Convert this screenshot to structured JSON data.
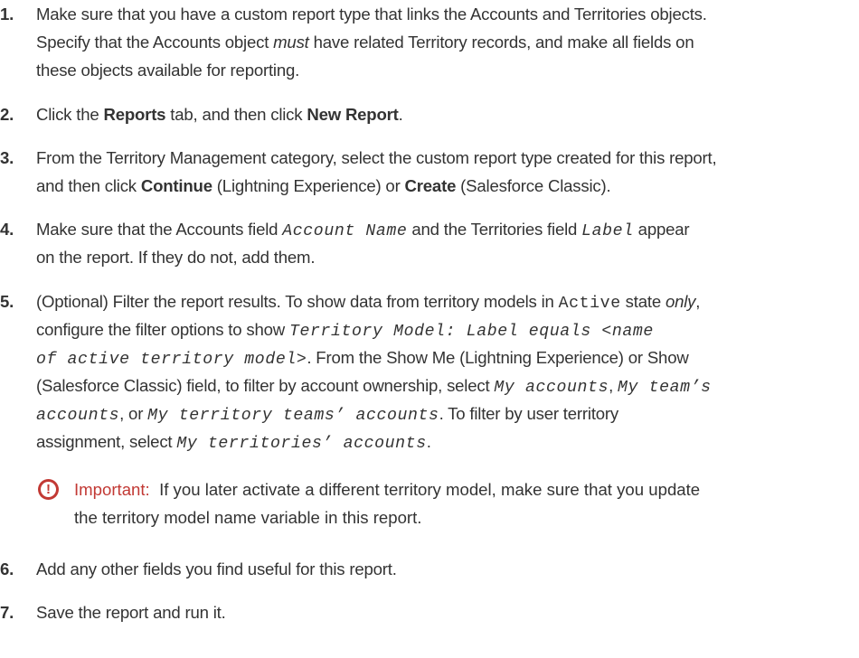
{
  "steps": [
    {
      "num": "1.",
      "lines": [
        "Make sure that you have a custom report type that links the Accounts and Territories objects.",
        [
          "Specify that the Accounts object ",
          {
            "i": "must"
          },
          " have related Territory records, and make all fields on"
        ],
        "these objects available for reporting."
      ]
    },
    {
      "num": "2.",
      "lines": [
        [
          "Click the ",
          {
            "b": "Reports"
          },
          " tab, and then click ",
          {
            "b": "New Report"
          },
          "."
        ]
      ]
    },
    {
      "num": "3.",
      "lines": [
        "From the Territory Management category, select the custom report type created for this report,",
        [
          "and then click ",
          {
            "b": "Continue"
          },
          " (Lightning Experience) or ",
          {
            "b": "Create"
          },
          " (Salesforce Classic)."
        ]
      ]
    },
    {
      "num": "4.",
      "lines": [
        [
          "Make sure that the Accounts field ",
          {
            "ci": "Account Name"
          },
          " and the Territories field ",
          {
            "ci": "Label"
          },
          " appear"
        ],
        "on the report. If they do not, add them."
      ]
    },
    {
      "num": "5.",
      "lines": [
        [
          "(Optional) Filter the report results. To show data from territory models in ",
          {
            "c": "Active"
          },
          " state ",
          {
            "i": "only"
          },
          ","
        ],
        [
          "configure the filter options to show ",
          {
            "ci": "Territory Model: Label equals <name"
          }
        ],
        [
          {
            "ci": " of active territory model>"
          },
          ". From the Show Me (Lightning Experience) or Show"
        ],
        [
          "(Salesforce Classic) field, to filter by account ownership, select ",
          {
            "ci": "My accounts"
          },
          ", ",
          {
            "ci": "My team’s"
          }
        ],
        [
          {
            "ci": "accounts"
          },
          ", or ",
          {
            "ci": "My territory teams’ accounts"
          },
          ". To filter by user territory"
        ],
        [
          "assignment, select ",
          {
            "ci": "My territories’ accounts"
          },
          "."
        ]
      ]
    },
    {
      "num": "6.",
      "lines": [
        "Add any other fields you find useful for this report."
      ]
    },
    {
      "num": "7.",
      "lines": [
        "Save the report and run it."
      ]
    }
  ],
  "important": {
    "label": "Important:",
    "line1": "If you later activate a different territory model, make sure that you update",
    "line2": "the territory model name variable in this report."
  }
}
